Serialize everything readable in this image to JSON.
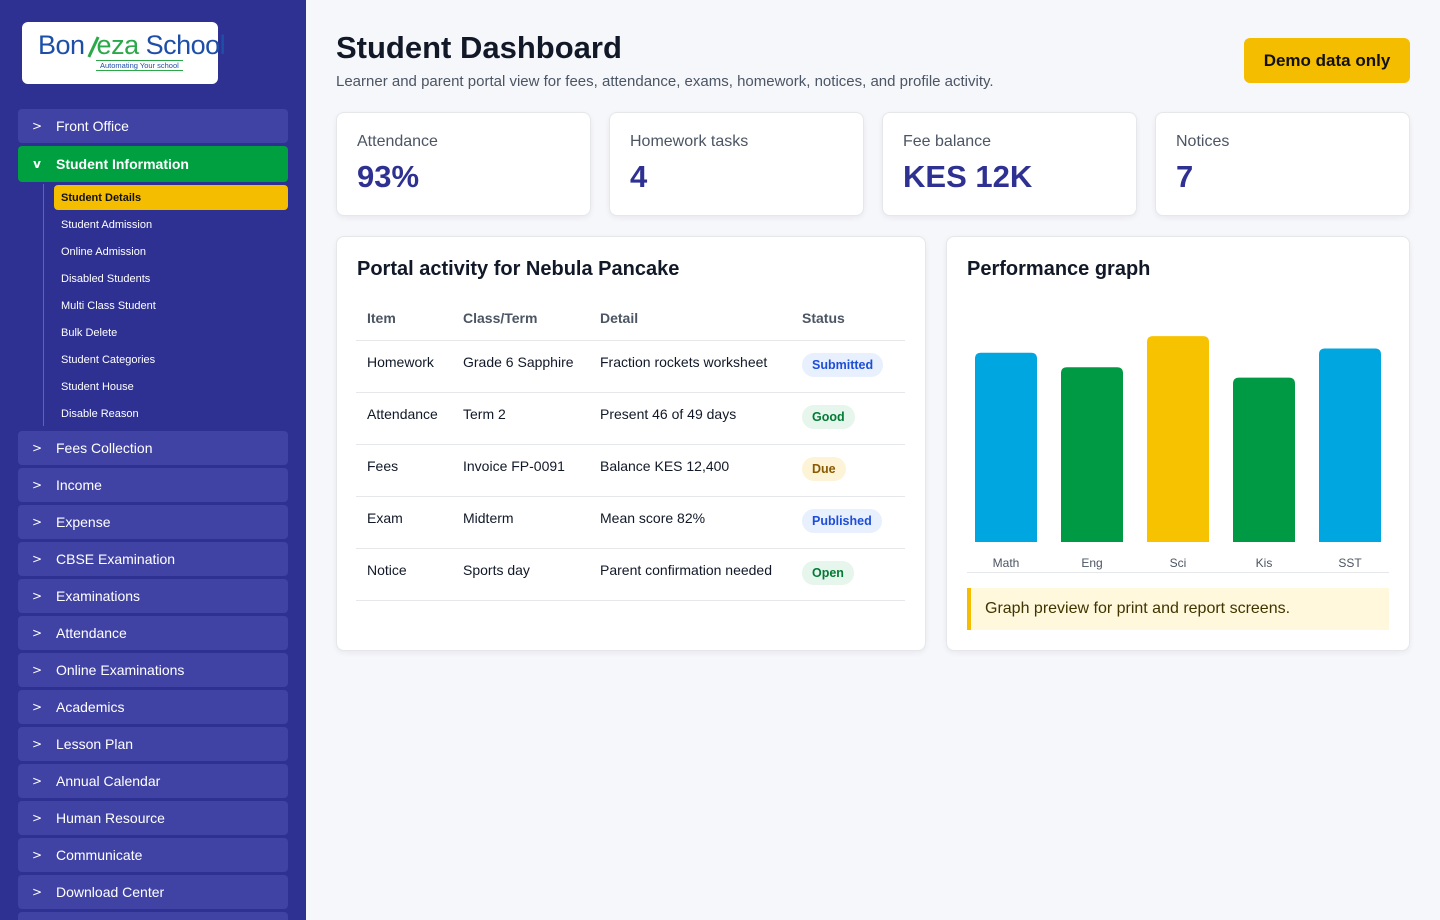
{
  "sidebar": {
    "logo": {
      "brand_start": "Bon",
      "brand_mid": "eza",
      "brand_end": " School",
      "tagline": "Automating Your school"
    },
    "items": [
      {
        "label": "Front Office",
        "chevron": ">"
      },
      {
        "label": "Student Information",
        "chevron": "v",
        "active": true
      },
      {
        "label": "Fees Collection",
        "chevron": ">"
      },
      {
        "label": "Income",
        "chevron": ">"
      },
      {
        "label": "Expense",
        "chevron": ">"
      },
      {
        "label": "CBSE Examination",
        "chevron": ">"
      },
      {
        "label": "Examinations",
        "chevron": ">"
      },
      {
        "label": "Attendance",
        "chevron": ">"
      },
      {
        "label": "Online Examinations",
        "chevron": ">"
      },
      {
        "label": "Academics",
        "chevron": ">"
      },
      {
        "label": "Lesson Plan",
        "chevron": ">"
      },
      {
        "label": "Annual Calendar",
        "chevron": ">"
      },
      {
        "label": "Human Resource",
        "chevron": ">"
      },
      {
        "label": "Communicate",
        "chevron": ">"
      },
      {
        "label": "Download Center",
        "chevron": ">"
      }
    ],
    "sub_items": [
      {
        "label": "Student Details",
        "active": true
      },
      {
        "label": "Student Admission"
      },
      {
        "label": "Online Admission"
      },
      {
        "label": "Disabled Students"
      },
      {
        "label": "Multi Class Student"
      },
      {
        "label": "Bulk Delete"
      },
      {
        "label": "Student Categories"
      },
      {
        "label": "Student House"
      },
      {
        "label": "Disable Reason"
      }
    ]
  },
  "header": {
    "title": "Student Dashboard",
    "subtitle": "Learner and parent portal view for fees, attendance, exams, homework, notices, and profile activity.",
    "demo_button": "Demo data only"
  },
  "stats": [
    {
      "label": "Attendance",
      "value": "93%"
    },
    {
      "label": "Homework tasks",
      "value": "4"
    },
    {
      "label": "Fee balance",
      "value": "KES 12K"
    },
    {
      "label": "Notices",
      "value": "7"
    }
  ],
  "activity": {
    "title": "Portal activity for Nebula Pancake",
    "columns": [
      "Item",
      "Class/Term",
      "Detail",
      "Status"
    ],
    "rows": [
      {
        "item": "Homework",
        "class_term": "Grade 6 Sapphire",
        "detail": "Fraction rockets worksheet",
        "status": "Submitted",
        "status_kind": "info"
      },
      {
        "item": "Attendance",
        "class_term": "Term 2",
        "detail": "Present 46 of 49 days",
        "status": "Good",
        "status_kind": "success"
      },
      {
        "item": "Fees",
        "class_term": "Invoice FP-0091",
        "detail": "Balance KES 12,400",
        "status": "Due",
        "status_kind": "warning"
      },
      {
        "item": "Exam",
        "class_term": "Midterm",
        "detail": "Mean score 82%",
        "status": "Published",
        "status_kind": "info"
      },
      {
        "item": "Notice",
        "class_term": "Sports day",
        "detail": "Parent confirmation needed",
        "status": "Open",
        "status_kind": "success"
      }
    ]
  },
  "performance": {
    "title": "Performance graph",
    "note": "Graph preview for print and report screens."
  },
  "colors": {
    "sidebar_bg": "#2e3192",
    "accent_green": "#00a041",
    "accent_yellow": "#f5bd00",
    "accent_blue": "#00a6df",
    "stat_value": "#2e3192"
  },
  "chart_data": {
    "type": "bar",
    "categories": [
      "Math",
      "Eng",
      "Sci",
      "Kis",
      "SST"
    ],
    "values": [
      91,
      84,
      99,
      79,
      93
    ],
    "bar_colors": [
      "#00a6df",
      "#009a44",
      "#f7c300",
      "#009a44",
      "#00a6df"
    ],
    "ylim": [
      0,
      100
    ],
    "grid": false,
    "legend": "none"
  }
}
